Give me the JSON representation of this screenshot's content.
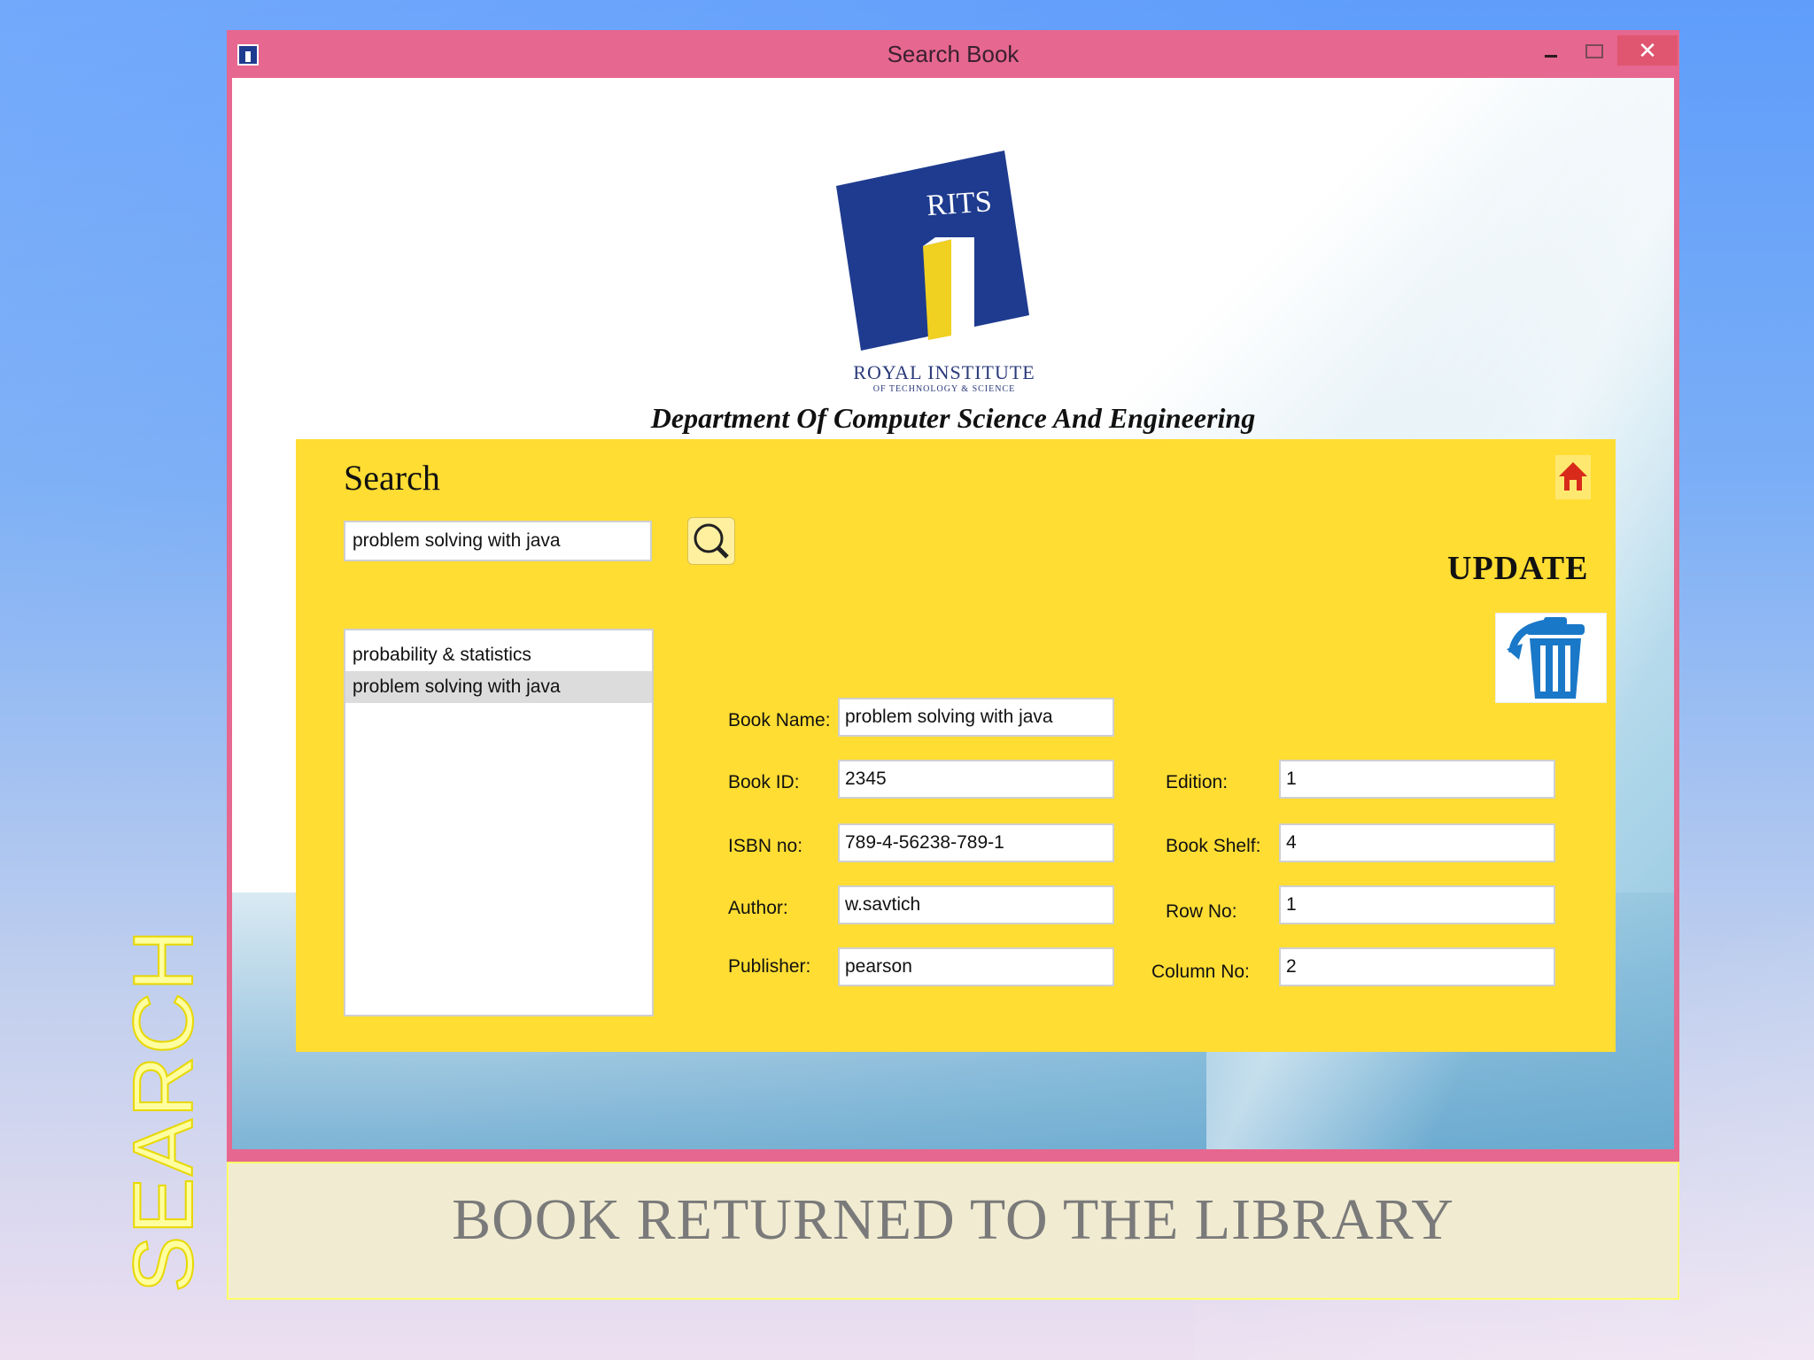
{
  "slide": {
    "title": "SEARCH",
    "caption": "BOOK RETURNED TO THE LIBRARY"
  },
  "window": {
    "title": "Search Book",
    "controls": {
      "minimize": "minimize-icon",
      "maximize": "maximize-icon",
      "close": "✕"
    }
  },
  "header": {
    "logo_text": "RITS",
    "institute_name": "ROYAL INSTITUTE",
    "institute_sub": "OF TECHNOLOGY & SCIENCE",
    "department": "Department Of Computer Science And Engineering"
  },
  "search": {
    "heading": "Search",
    "query": "problem solving with java",
    "results": [
      {
        "label": "probability & statistics",
        "selected": false
      },
      {
        "label": "problem solving with java",
        "selected": true
      }
    ]
  },
  "actions": {
    "update_label": "UPDATE"
  },
  "book": {
    "name_label": "Book Name:",
    "name": "problem solving with java",
    "id_label": "Book ID:",
    "id": "2345",
    "isbn_label": "ISBN no:",
    "isbn": "789-4-56238-789-1",
    "author_label": "Author:",
    "author": "w.savtich",
    "publisher_label": "Publisher:",
    "publisher": "pearson",
    "edition_label": "Edition:",
    "edition": "1",
    "shelf_label": "Book Shelf:",
    "shelf": "4",
    "row_label": "Row No:",
    "row": "1",
    "column_label": "Column No:",
    "column": "2"
  },
  "colors": {
    "title_bar": "#e6678f",
    "panel": "#ffdd33",
    "logo_blue": "#1e3b8f",
    "logo_yellow": "#f0d020"
  }
}
